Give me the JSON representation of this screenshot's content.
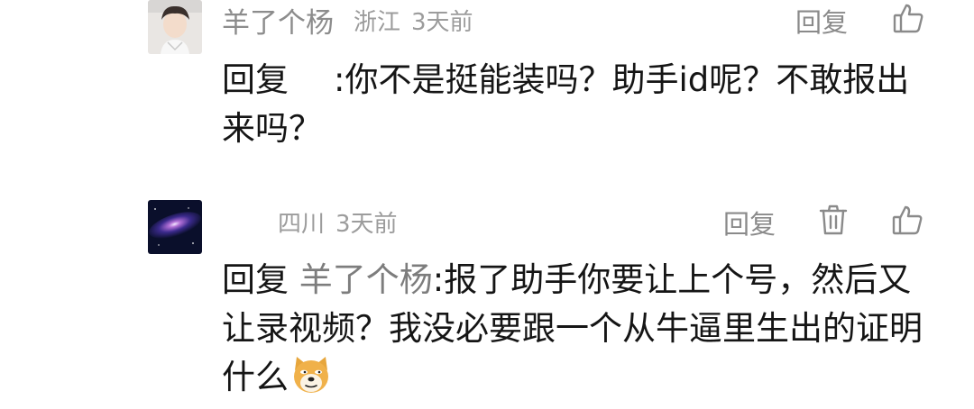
{
  "comments": [
    {
      "username": "羊了个杨",
      "location": "浙江",
      "time": "3天前",
      "reply_label": "回复",
      "reply_prefix": "回复",
      "reply_target": "",
      "colon": ":",
      "text": "你不是挺能装吗？助手id呢？不敢报出来吗？",
      "icons": [
        "like-icon"
      ]
    },
    {
      "username": "",
      "location": "四川",
      "time": "3天前",
      "reply_label": "回复",
      "reply_prefix": "回复",
      "reply_target": "羊了个杨",
      "colon": ":",
      "text": "报了助手你要让上个号，然后又让录视频？我没必要跟一个从牛逼里生出的证明什么",
      "emoji": "doge-emoji",
      "icons": [
        "delete-icon",
        "like-icon"
      ]
    }
  ],
  "colors": {
    "meta": "#9c9c9c",
    "text": "#151515",
    "reply_target": "#7d7d7d"
  }
}
